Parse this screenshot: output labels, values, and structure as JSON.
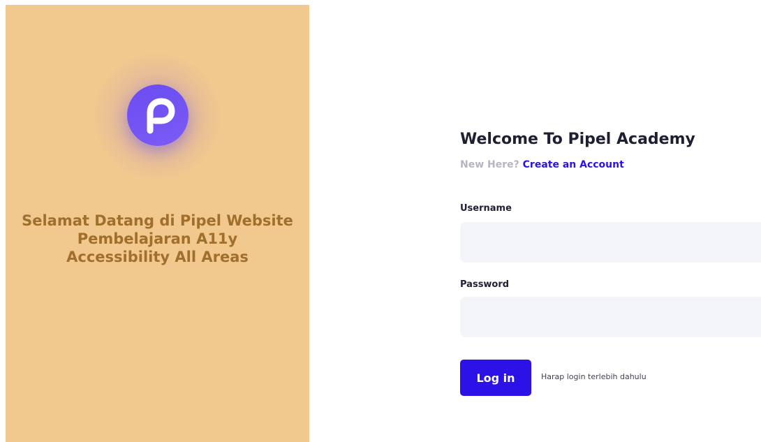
{
  "aside": {
    "logo_letter": "p",
    "title_lines": [
      "Selamat Datang di Pipel Website",
      "Pembelajaran A11y",
      "Accessibility All Areas"
    ],
    "background_color": "#f1c88d",
    "title_color": "#a06f2c",
    "logo_color": "#6a4cf2"
  },
  "form": {
    "heading": "Welcome To Pipel Academy",
    "new_here": "New Here?",
    "create_account": "Create an Account",
    "username_label": "Username",
    "username_value": "",
    "password_label": "Password",
    "password_value": "",
    "login_button": "Log in",
    "login_hint": "Harap login terlebih dahulu",
    "accent_color": "#2d12e8"
  }
}
